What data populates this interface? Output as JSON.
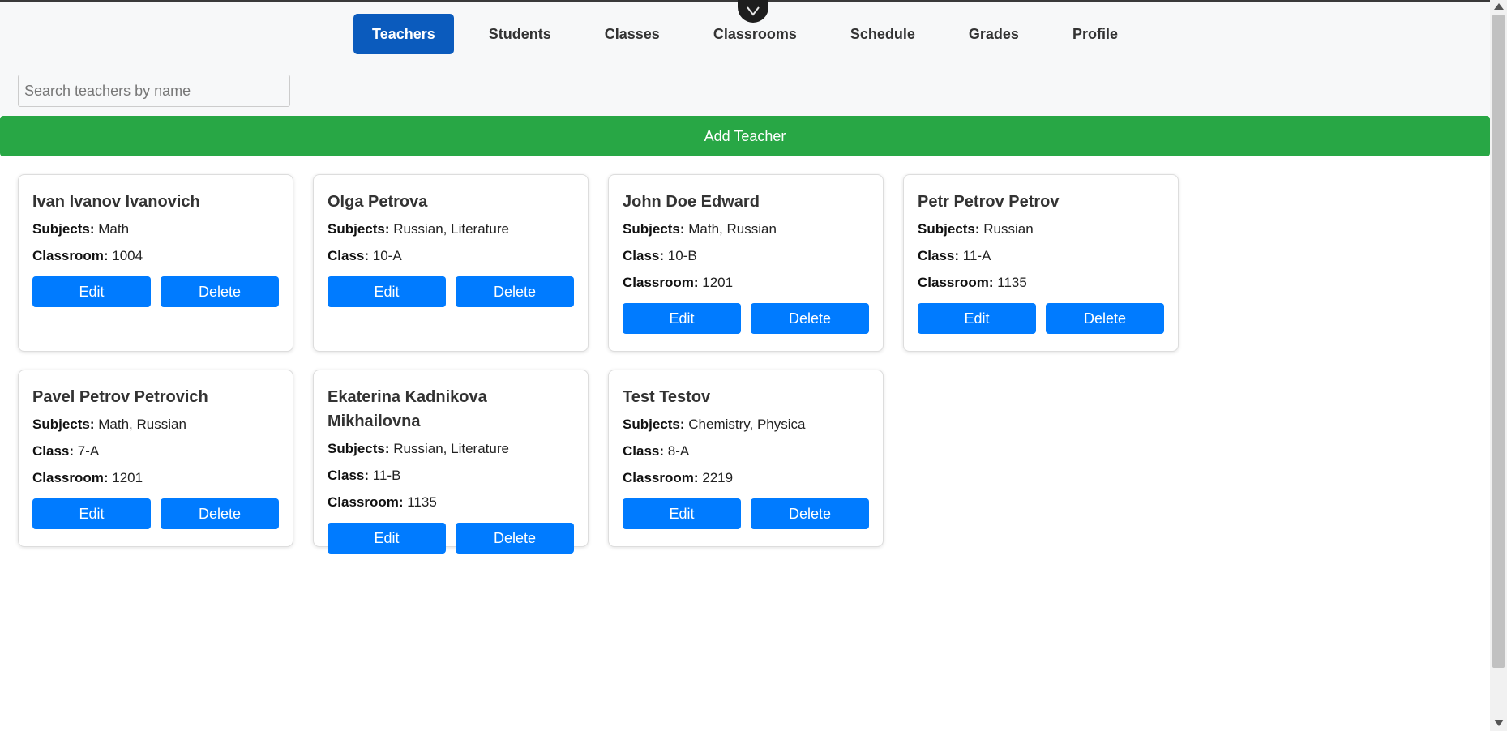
{
  "nav": {
    "items": [
      {
        "label": "Teachers",
        "active": true
      },
      {
        "label": "Students",
        "active": false
      },
      {
        "label": "Classes",
        "active": false
      },
      {
        "label": "Classrooms",
        "active": false
      },
      {
        "label": "Schedule",
        "active": false
      },
      {
        "label": "Grades",
        "active": false
      },
      {
        "label": "Profile",
        "active": false
      }
    ]
  },
  "search": {
    "placeholder": "Search teachers by name",
    "value": ""
  },
  "add_button": {
    "label": "Add Teacher"
  },
  "labels": {
    "subjects": "Subjects:",
    "class": "Class:",
    "classroom": "Classroom:",
    "edit": "Edit",
    "delete": "Delete"
  },
  "teachers": [
    {
      "name": "Ivan Ivanov Ivanovich",
      "subjects": "Math",
      "classroom": "1004"
    },
    {
      "name": "Olga Petrova",
      "subjects": "Russian, Literature",
      "class": "10-A"
    },
    {
      "name": "John Doe Edward",
      "subjects": "Math, Russian",
      "class": "10-B",
      "classroom": "1201"
    },
    {
      "name": "Petr Petrov Petrov",
      "subjects": "Russian",
      "class": "11-A",
      "classroom": "1135"
    },
    {
      "name": "Pavel Petrov Petrovich",
      "subjects": "Math, Russian",
      "class": "7-A",
      "classroom": "1201"
    },
    {
      "name": "Ekaterina Kadnikova Mikhailovna",
      "subjects": "Russian, Literature",
      "class": "11-B",
      "classroom": "1135"
    },
    {
      "name": "Test Testov",
      "subjects": "Chemistry, Physica",
      "class": "8-A",
      "classroom": "2219"
    }
  ],
  "colors": {
    "nav_active": "#0b5bbd",
    "add_button": "#28a745",
    "card_button": "#007bff"
  },
  "icons": {
    "devtools_toggle": "chevron-down-icon"
  }
}
